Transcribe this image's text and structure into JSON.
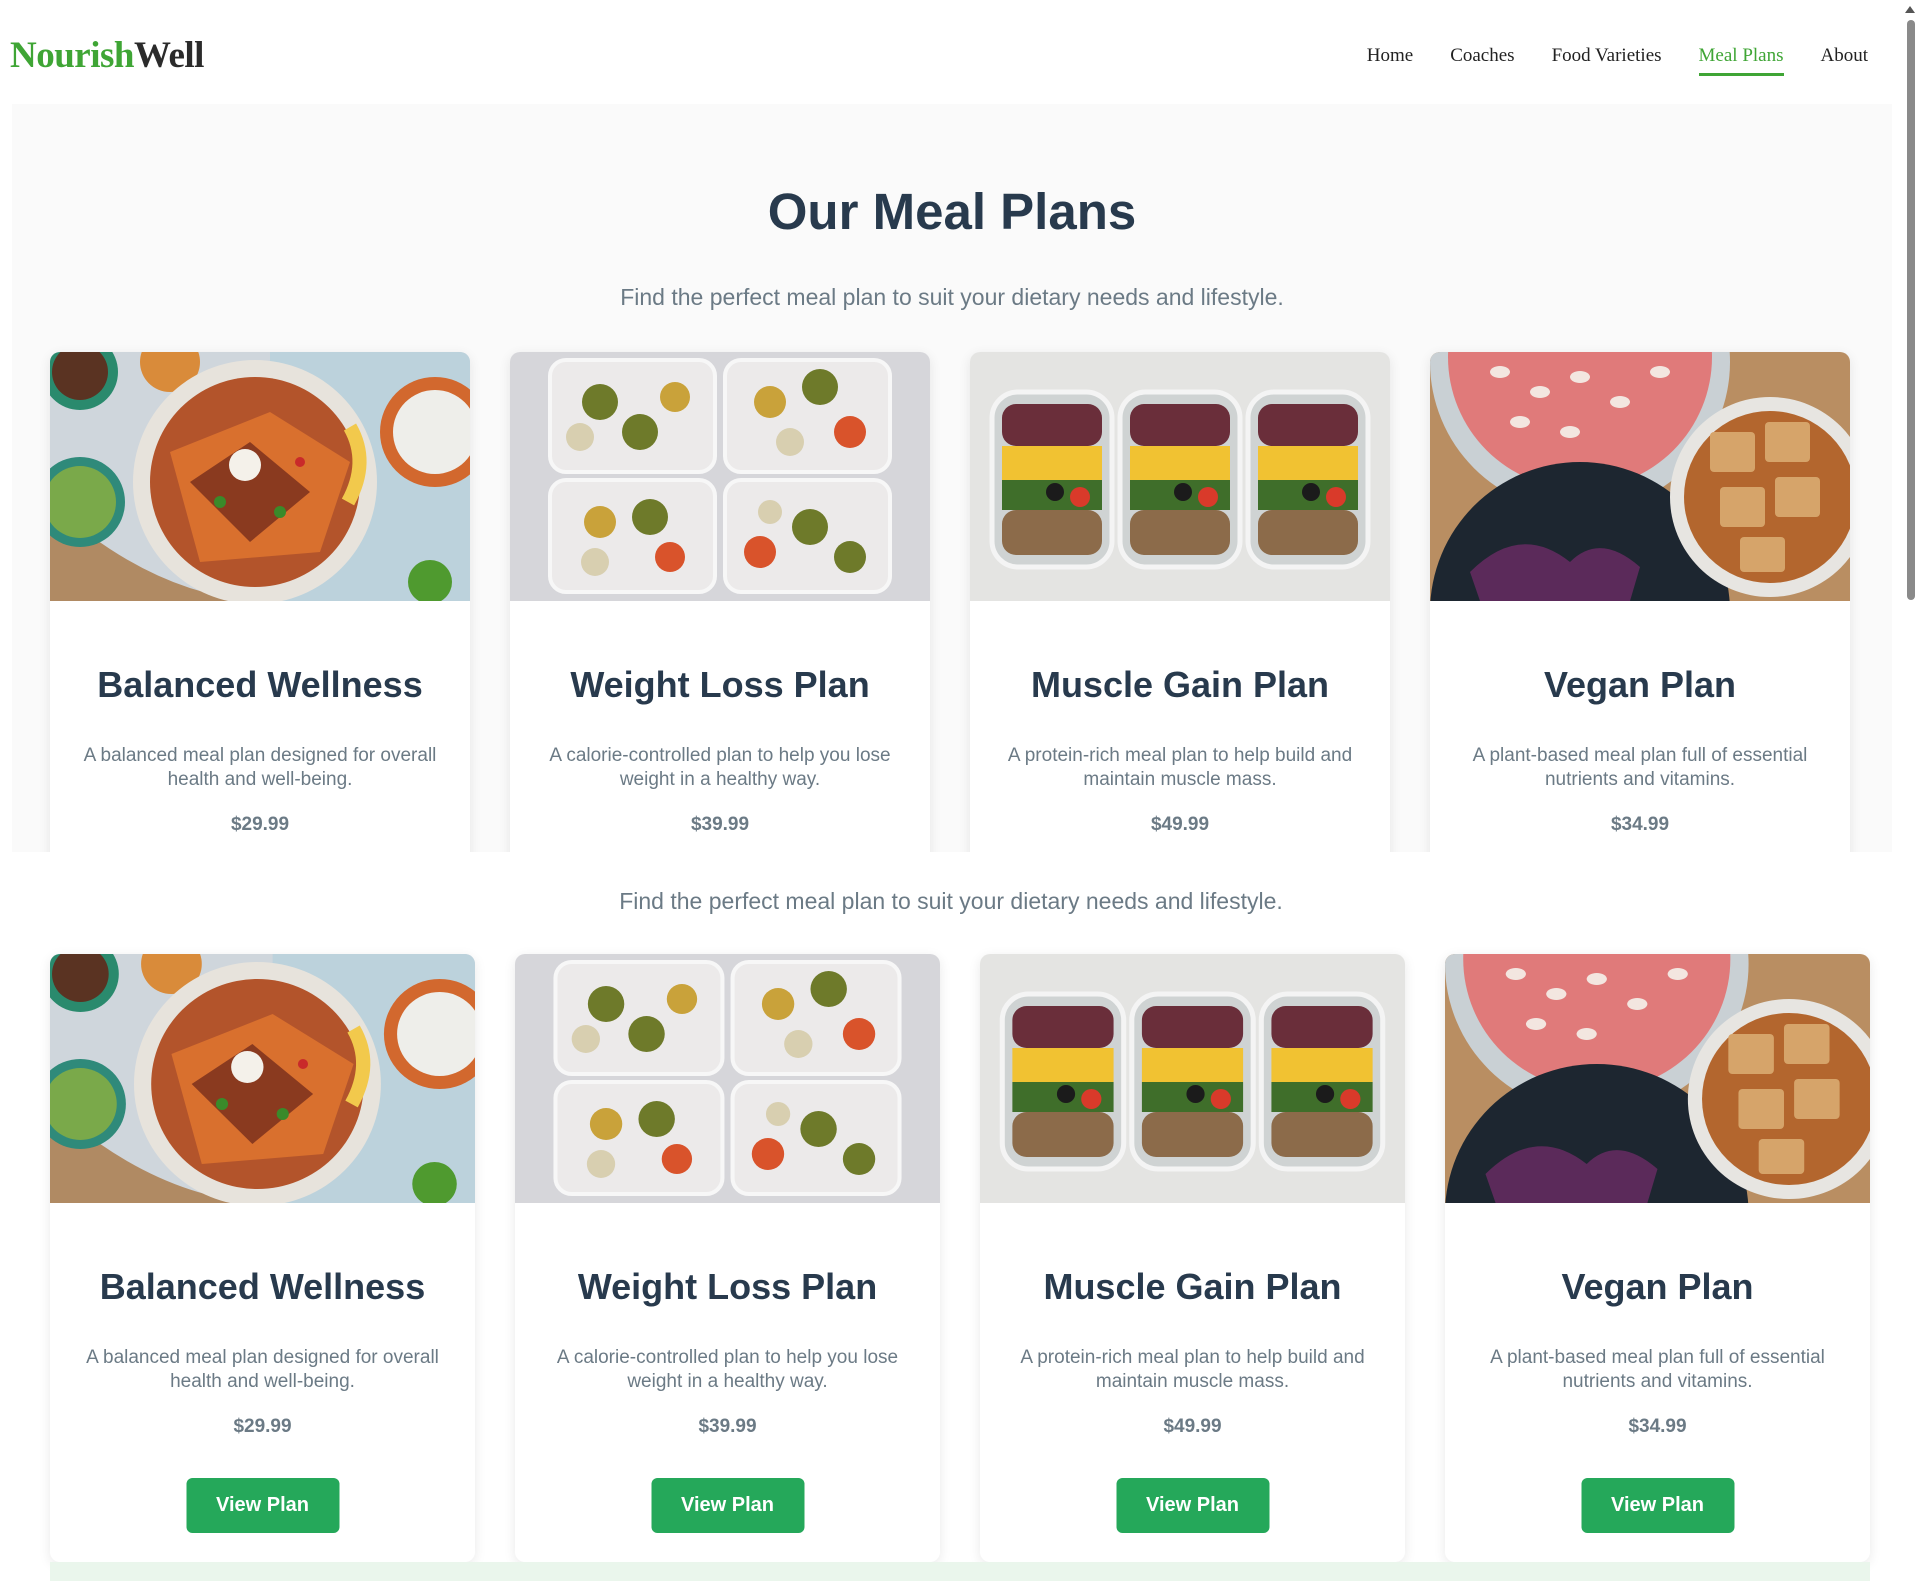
{
  "logo": {
    "part1": "Nourish",
    "part2": "Well"
  },
  "nav": {
    "items": [
      "Home",
      "Coaches",
      "Food Varieties",
      "Meal Plans",
      "About"
    ],
    "active": "Meal Plans"
  },
  "page": {
    "title": "Our Meal Plans",
    "subtitle": "Find the perfect meal plan to suit your dietary needs and lifestyle."
  },
  "section2": {
    "subtitle": "Find the perfect meal plan to suit your dietary needs and lifestyle.",
    "button_label": "View Plan"
  },
  "plans": [
    {
      "name": "Balanced Wellness",
      "description": "A balanced meal plan designed for overall health and well-being.",
      "price": "$29.99",
      "image": "sweet-potato-bowl-photo"
    },
    {
      "name": "Weight Loss Plan",
      "description": "A calorie-controlled plan to help you lose weight in a healthy way.",
      "price": "$39.99",
      "image": "meal-prep-containers-photo"
    },
    {
      "name": "Muscle Gain Plan",
      "description": "A protein-rich meal plan to help build and maintain muscle mass.",
      "price": "$49.99",
      "image": "rice-corn-bowls-photo"
    },
    {
      "name": "Vegan Plan",
      "description": "A plant-based meal plan full of essential nutrients and vitamins.",
      "price": "$34.99",
      "image": "tofu-beans-bowls-photo"
    }
  ],
  "colors": {
    "brand_green": "#3fa535",
    "button_green": "#25a85a",
    "heading": "#283a4d",
    "muted": "#6b7a85"
  }
}
